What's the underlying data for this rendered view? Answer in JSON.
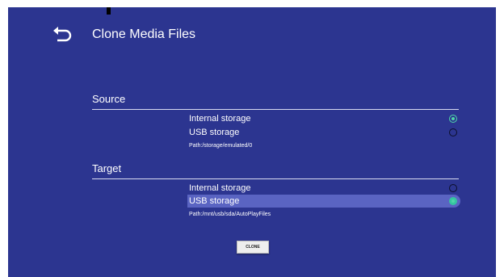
{
  "header": {
    "title": "Clone Media Files"
  },
  "source": {
    "label": "Source",
    "options": [
      {
        "label": "Internal storage",
        "selected": true
      },
      {
        "label": "USB storage",
        "selected": false
      }
    ],
    "path": "Path:/storage/emulated/0"
  },
  "target": {
    "label": "Target",
    "options": [
      {
        "label": "Internal storage",
        "selected": false
      },
      {
        "label": "USB storage",
        "selected": true
      }
    ],
    "path": "Path:/mnt/usb/sda/AutoPlayFiles"
  },
  "actions": {
    "clone_label": "CLONE"
  },
  "colors": {
    "background": "#2c3590",
    "highlight": "#5a64c2",
    "radio_on": "#4fd7a8"
  }
}
